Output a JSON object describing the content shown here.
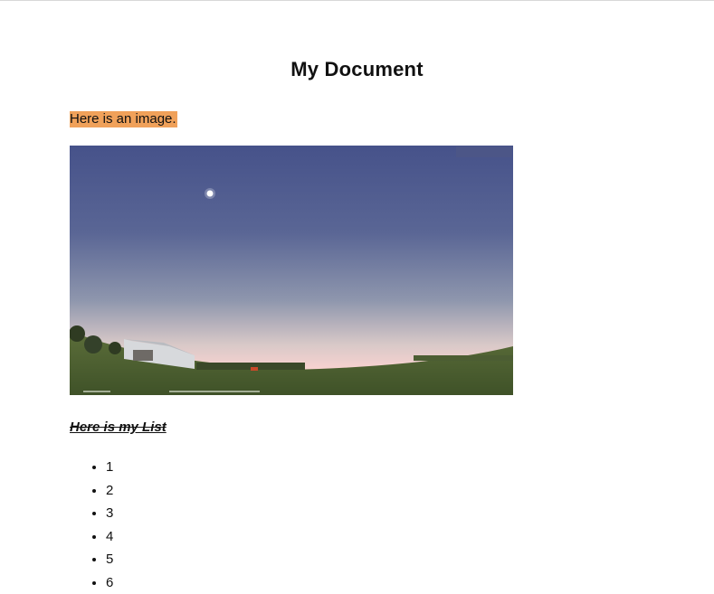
{
  "document": {
    "title": "My Document",
    "intro_text": "Here is an image.",
    "intro_highlight_color": "#f0a15a",
    "list_heading": "Here is my List",
    "list_items": [
      "1",
      "2",
      "3",
      "4",
      "5",
      "6"
    ]
  },
  "image": {
    "subject": "night-sky-panorama",
    "sky_top_color": "#465184",
    "horizon_color": "#f7d4d4",
    "ground_color": "#4a5d2e"
  }
}
